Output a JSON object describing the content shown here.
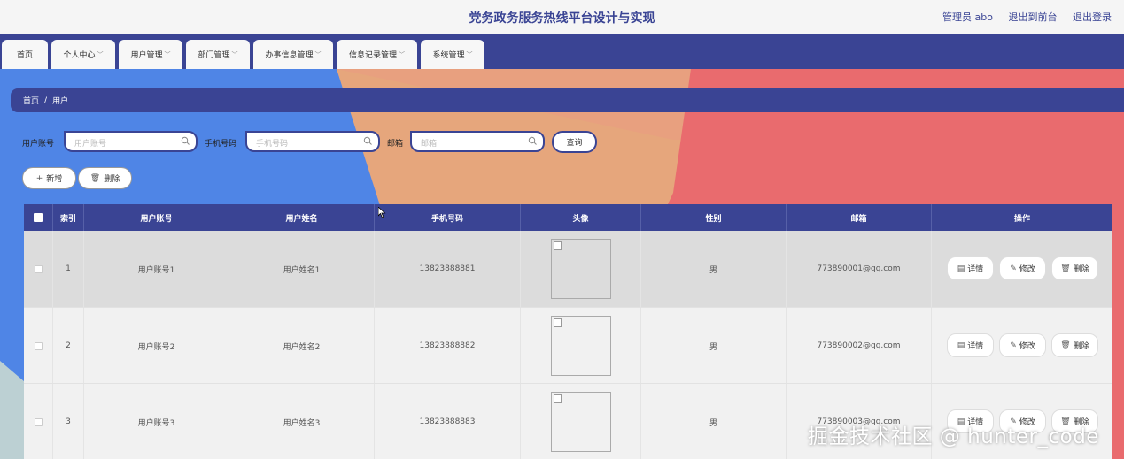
{
  "header": {
    "title": "党务政务服务热线平台设计与实现",
    "user": "管理员 abo",
    "back_front": "退出到前台",
    "logout": "退出登录"
  },
  "nav": {
    "items": [
      {
        "label": "首页"
      },
      {
        "label": "个人中心"
      },
      {
        "label": "用户管理"
      },
      {
        "label": "部门管理"
      },
      {
        "label": "办事信息管理"
      },
      {
        "label": "信息记录管理"
      },
      {
        "label": "系统管理"
      }
    ]
  },
  "breadcrumb": {
    "home": "首页",
    "sep": "/",
    "current": "用户"
  },
  "search": {
    "account_label": "用户账号",
    "account_placeholder": "用户账号",
    "phone_label": "手机号码",
    "phone_placeholder": "手机号码",
    "email_label": "邮箱",
    "email_placeholder": "邮箱",
    "query_button": "查询"
  },
  "actions": {
    "add": "新增",
    "delete": "删除"
  },
  "table": {
    "columns": [
      "索引",
      "用户账号",
      "用户姓名",
      "手机号码",
      "头像",
      "性别",
      "邮箱",
      "操作"
    ],
    "rows": [
      {
        "index": "1",
        "account": "用户账号1",
        "name": "用户姓名1",
        "phone": "13823888881",
        "gender": "男",
        "email": "773890001@qq.com"
      },
      {
        "index": "2",
        "account": "用户账号2",
        "name": "用户姓名2",
        "phone": "13823888882",
        "gender": "男",
        "email": "773890002@qq.com"
      },
      {
        "index": "3",
        "account": "用户账号3",
        "name": "用户姓名3",
        "phone": "13823888883",
        "gender": "男",
        "email": "773890003@qq.com"
      }
    ],
    "row_actions": {
      "detail": "详情",
      "edit": "修改",
      "delete": "删除"
    }
  },
  "watermark": "掘金技术社区 @ hunter_code",
  "colors": {
    "primary": "#3a4494",
    "blue": "#4f85e6",
    "peach": "#e6a67c",
    "red": "#e96b6e"
  }
}
